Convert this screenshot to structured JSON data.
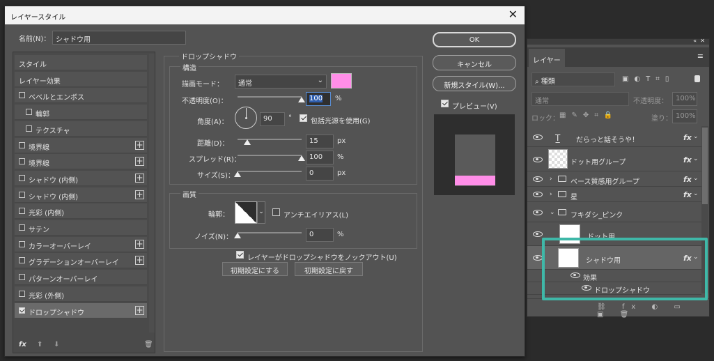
{
  "dialog": {
    "title": "レイヤースタイル",
    "name_label": "名前(N)：",
    "name_value": "シャドウ用",
    "ok": "OK",
    "cancel": "キャンセル",
    "new_style": "新規スタイル(W)...",
    "preview_label": "プレビュー(V)"
  },
  "styles_list": {
    "items": [
      {
        "label": "スタイル",
        "checkbox": false,
        "plus": false,
        "indent": 0,
        "selected": false
      },
      {
        "label": "レイヤー効果",
        "checkbox": false,
        "plus": false,
        "indent": 0,
        "selected": false
      },
      {
        "label": "ベベルとエンボス",
        "checkbox": true,
        "checked": false,
        "plus": false,
        "indent": 0
      },
      {
        "label": "輪郭",
        "checkbox": true,
        "checked": false,
        "plus": false,
        "indent": 1
      },
      {
        "label": "テクスチャ",
        "checkbox": true,
        "checked": false,
        "plus": false,
        "indent": 1
      },
      {
        "label": "境界線",
        "checkbox": true,
        "checked": false,
        "plus": true,
        "indent": 0
      },
      {
        "label": "境界線",
        "checkbox": true,
        "checked": false,
        "plus": true,
        "indent": 0
      },
      {
        "label": "シャドウ (内側)",
        "checkbox": true,
        "checked": false,
        "plus": true,
        "indent": 0
      },
      {
        "label": "シャドウ (内側)",
        "checkbox": true,
        "checked": false,
        "plus": true,
        "indent": 0
      },
      {
        "label": "光彩 (内側)",
        "checkbox": true,
        "checked": false,
        "plus": false,
        "indent": 0
      },
      {
        "label": "サテン",
        "checkbox": true,
        "checked": false,
        "plus": false,
        "indent": 0
      },
      {
        "label": "カラーオーバーレイ",
        "checkbox": true,
        "checked": false,
        "plus": true,
        "indent": 0
      },
      {
        "label": "グラデーションオーバーレイ",
        "checkbox": true,
        "checked": false,
        "plus": true,
        "indent": 0
      },
      {
        "label": "パターンオーバーレイ",
        "checkbox": true,
        "checked": false,
        "plus": false,
        "indent": 0
      },
      {
        "label": "光彩 (外側)",
        "checkbox": true,
        "checked": false,
        "plus": false,
        "indent": 0
      },
      {
        "label": "ドロップシャドウ",
        "checkbox": true,
        "checked": true,
        "plus": true,
        "indent": 0,
        "selected": true
      }
    ],
    "footer_fx": "fx"
  },
  "drop_shadow": {
    "section_title": "ドロップシャドウ",
    "structure_title": "構造",
    "blend_mode_label": "描画モード：",
    "blend_mode_value": "通常",
    "opacity_label": "不透明度(O)：",
    "opacity_value": "100",
    "opacity_unit": "%",
    "angle_label": "角度(A)：",
    "angle_value": "90",
    "angle_unit": "°",
    "global_light_label": "包括光源を使用(G)",
    "distance_label": "距離(D)：",
    "distance_value": "15",
    "distance_unit": "px",
    "spread_label": "スプレッド(R)：",
    "spread_value": "100",
    "spread_unit": "%",
    "size_label": "サイズ(S)：",
    "size_value": "0",
    "size_unit": "px",
    "quality_title": "画質",
    "contour_label": "輪郭：",
    "antialias_label": "アンチエイリアス(L)",
    "noise_label": "ノイズ(N)：",
    "noise_value": "0",
    "noise_unit": "%",
    "knockout_label": "レイヤーがドロップシャドウをノックアウト(U)",
    "set_default": "初期設定にする",
    "reset_default": "初期設定に戻す",
    "color": "#ff8ee8",
    "opacity_level": 1.0,
    "distance_level": 0.15,
    "spread_level": 1.0,
    "size_level": 0.0,
    "noise_level": 0.0
  },
  "layers_panel": {
    "tab": "レイヤー",
    "search_value": "種類",
    "blend_value": "通常",
    "opacity_label": "不透明度：",
    "opacity_value": "100%",
    "lock_label": "ロック：",
    "fill_label": "塗り：",
    "fill_value": "100%",
    "layers": [
      {
        "name": "だらっと話そうや！",
        "type": "text",
        "fx": true
      },
      {
        "name": "ドット用グループ",
        "type": "smart",
        "fx": true
      },
      {
        "name": "ベース質感用グループ",
        "type": "folder",
        "fx": true
      },
      {
        "name": "星",
        "type": "folder",
        "fx": true
      },
      {
        "name": "フキダシ_ピンク",
        "type": "folder-open",
        "fx": false
      },
      {
        "name": "ドット用",
        "type": "layer",
        "fx": false
      },
      {
        "name": "シャドウ用",
        "type": "layer",
        "fx": true,
        "selected": true
      }
    ],
    "effects_label": "効果",
    "effect_item": "ドロップシャドウ",
    "fx_symbol": "fx",
    "highlight_color": "#3fb8a8"
  }
}
